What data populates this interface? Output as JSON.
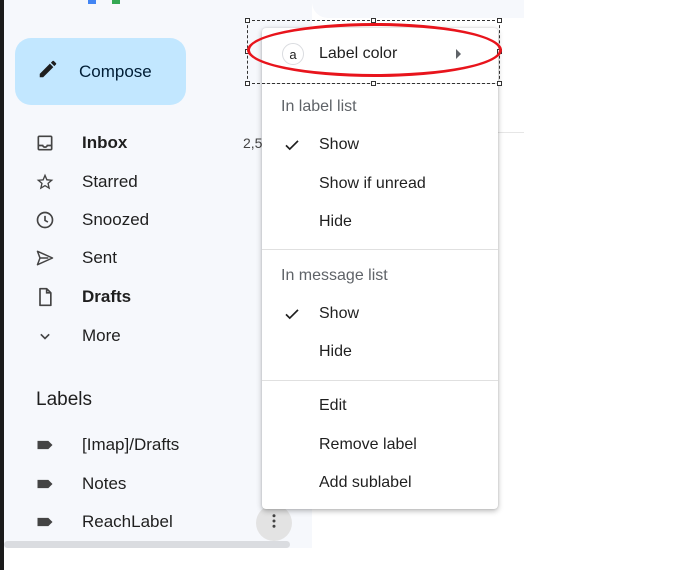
{
  "sidebar": {
    "compose_label": "Compose",
    "nav": [
      {
        "label": "Inbox",
        "icon": "inbox-icon",
        "count": "2,5"
      },
      {
        "label": "Starred",
        "icon": "star-icon"
      },
      {
        "label": "Snoozed",
        "icon": "clock-icon"
      },
      {
        "label": "Sent",
        "icon": "send-icon"
      },
      {
        "label": "Drafts",
        "icon": "draft-icon"
      },
      {
        "label": "More",
        "icon": "chevron-down-icon"
      }
    ],
    "labels_heading": "Labels",
    "labels": [
      {
        "label": "[Imap]/Drafts",
        "icon": "label-icon"
      },
      {
        "label": "Notes",
        "icon": "label-icon"
      },
      {
        "label": "ReachLabel",
        "icon": "label-icon"
      }
    ]
  },
  "menu": {
    "label_color": {
      "badge": "a",
      "label": "Label color"
    },
    "label_list_heading": "In label list",
    "label_list_options": [
      {
        "label": "Show",
        "checked": true
      },
      {
        "label": "Show if unread",
        "checked": false
      },
      {
        "label": "Hide",
        "checked": false
      }
    ],
    "message_list_heading": "In message list",
    "message_list_options": [
      {
        "label": "Show",
        "checked": true
      },
      {
        "label": "Hide",
        "checked": false
      }
    ],
    "actions": [
      {
        "label": "Edit"
      },
      {
        "label": "Remove label"
      },
      {
        "label": "Add sublabel"
      }
    ]
  },
  "colors": {
    "compose_bg": "#c2e7ff",
    "sidebar_bg": "#f6f8fc",
    "highlight_ellipse": "#e8141c"
  }
}
